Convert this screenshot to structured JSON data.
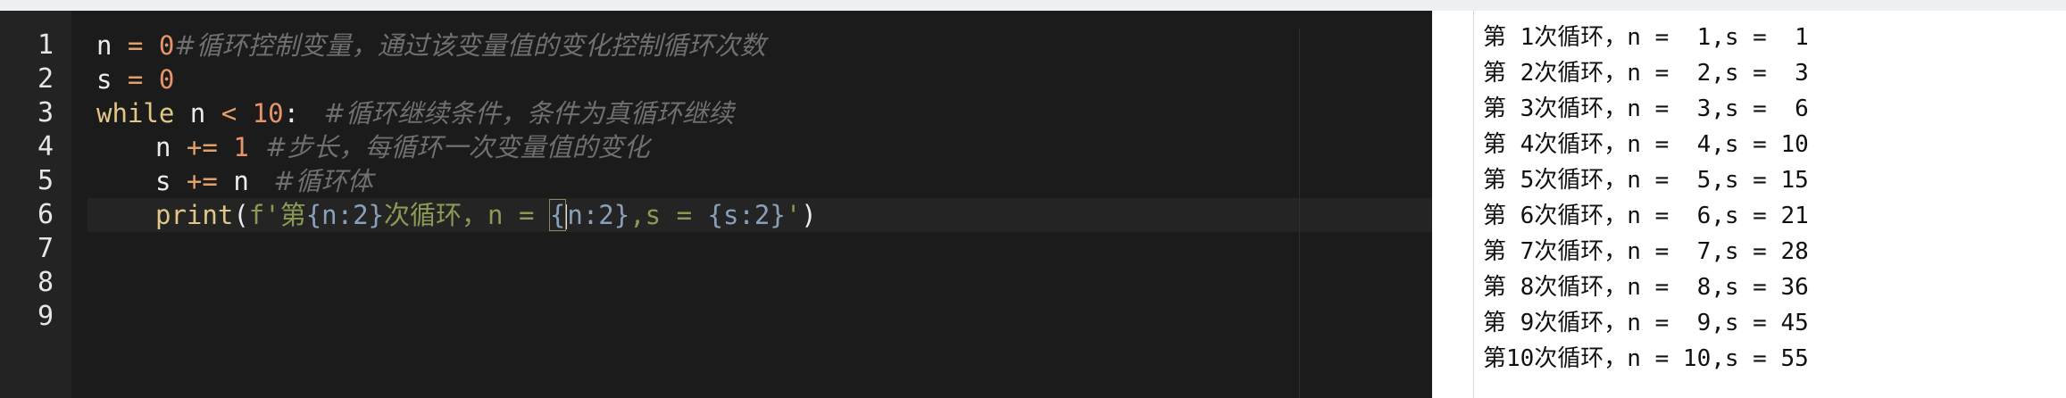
{
  "editor": {
    "line_numbers": [
      "1",
      "2",
      "3",
      "4",
      "5",
      "6",
      "7",
      "8",
      "9"
    ],
    "line1": {
      "var": "n",
      "eq": " = ",
      "num": "0",
      "comment": "#循环控制变量，通过该变量值的变化控制循环次数"
    },
    "line2": {
      "var": "s",
      "eq": " = ",
      "num": "0"
    },
    "line3": {
      "kw": "while",
      "cond_var": " n ",
      "op": "<",
      "num": " 10",
      "colon": ":",
      "comment": "   #循环继续条件，条件为真循环继续"
    },
    "line4": {
      "var": "n",
      "op": " += ",
      "num": "1",
      "comment": "  #步长，每循环一次变量值的变化"
    },
    "line5": {
      "var": "s",
      "op": " += ",
      "rhs": "n",
      "comment": "   #循环体"
    },
    "line6": {
      "fn": "print",
      "open": "(",
      "fprefix": "f'",
      "s1": "第",
      "i1": "{n:2}",
      "s2": "次循环，n = ",
      "brace": "{",
      "i2rest": "n:2}",
      "s3": ",s = ",
      "i3": "{s:2}",
      "close_quote": "'",
      "close": ")"
    }
  },
  "output": {
    "lines": [
      "第 1次循环，n =  1,s =  1",
      "第 2次循环，n =  2,s =  3",
      "第 3次循环，n =  3,s =  6",
      "第 4次循环，n =  4,s = 10",
      "第 5次循环，n =  5,s = 15",
      "第 6次循环，n =  6,s = 21",
      "第 7次循环，n =  7,s = 28",
      "第 8次循环，n =  8,s = 36",
      "第 9次循环，n =  9,s = 45",
      "第10次循环，n = 10,s = 55"
    ]
  },
  "colors": {
    "editor_bg": "#1b1b1b",
    "gutter_bg": "#232323",
    "keyword": "#e0c787",
    "number": "#e8946a",
    "comment": "#6f6f6f",
    "string": "#8a9a55"
  }
}
